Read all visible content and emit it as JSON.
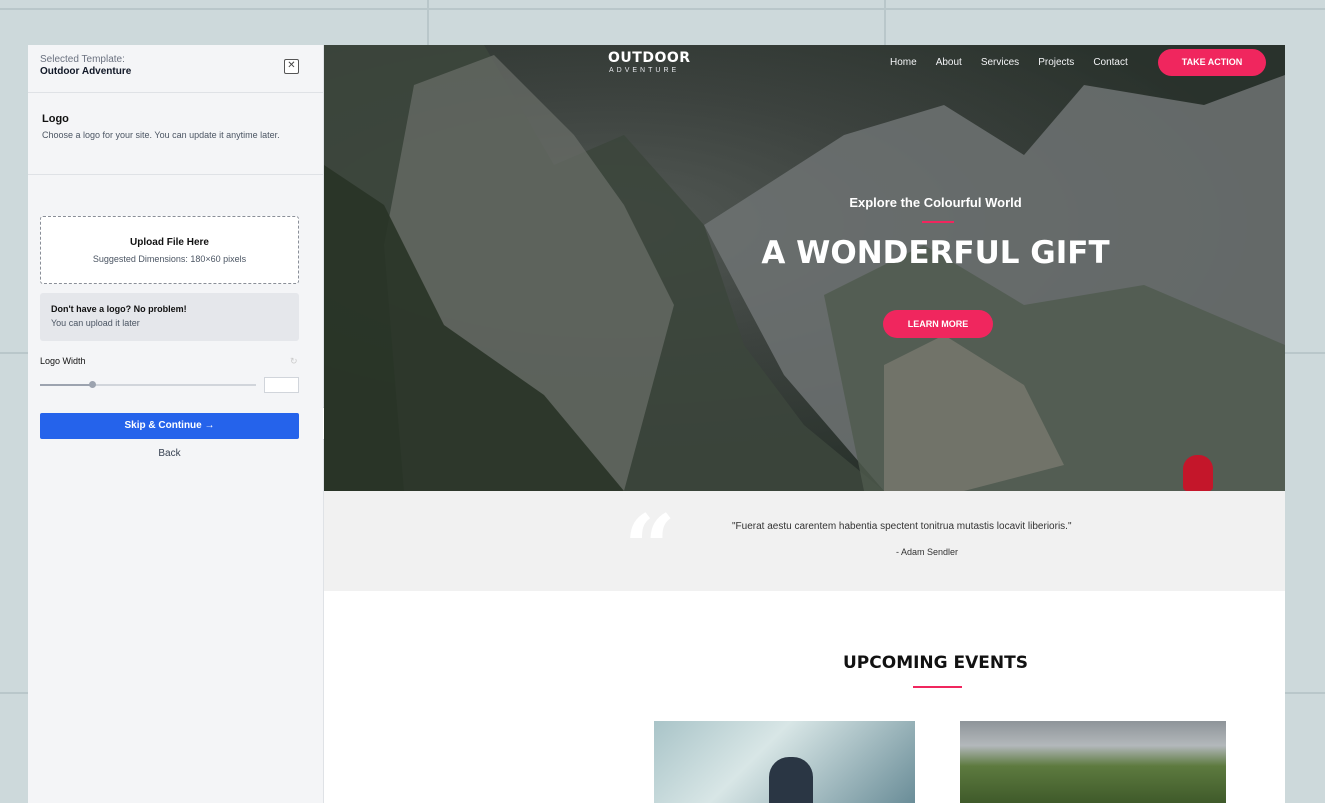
{
  "sidebar": {
    "selected_template_label": "Selected Template:",
    "selected_template_name": "Outdoor Adventure",
    "logo_section": {
      "title": "Logo",
      "description": "Choose a logo for your site. You can update it anytime later."
    },
    "upload": {
      "title": "Upload File Here",
      "hint": "Suggested Dimensions: 180×60 pixels"
    },
    "no_logo": {
      "title": "Don't have a logo? No problem!",
      "subtitle": "You can upload it later"
    },
    "logo_width": {
      "label": "Logo Width",
      "value_fraction": 0.24
    },
    "skip_button": "Skip & Continue →",
    "back_link": "Back"
  },
  "preview": {
    "logo_main": "OUTDOOR",
    "logo_sub": "ADVENTURE",
    "nav": [
      "Home",
      "About",
      "Services",
      "Projects",
      "Contact"
    ],
    "take_action": "TAKE ACTION",
    "hero_subtitle": "Explore the Colourful World",
    "hero_title": "A WONDERFUL GIFT",
    "learn_more": "LEARN MORE",
    "quote_mark": "“",
    "quote_text": "\"Fuerat aestu carentem habentia spectent tonitrua mutastis locavit liberioris.\"",
    "quote_author": "- Adam Sendler",
    "events_title": "UPCOMING EVENTS"
  },
  "colors": {
    "accent": "#f0265e",
    "primary_button": "#2563eb",
    "page_bg": "#cdd9db"
  }
}
